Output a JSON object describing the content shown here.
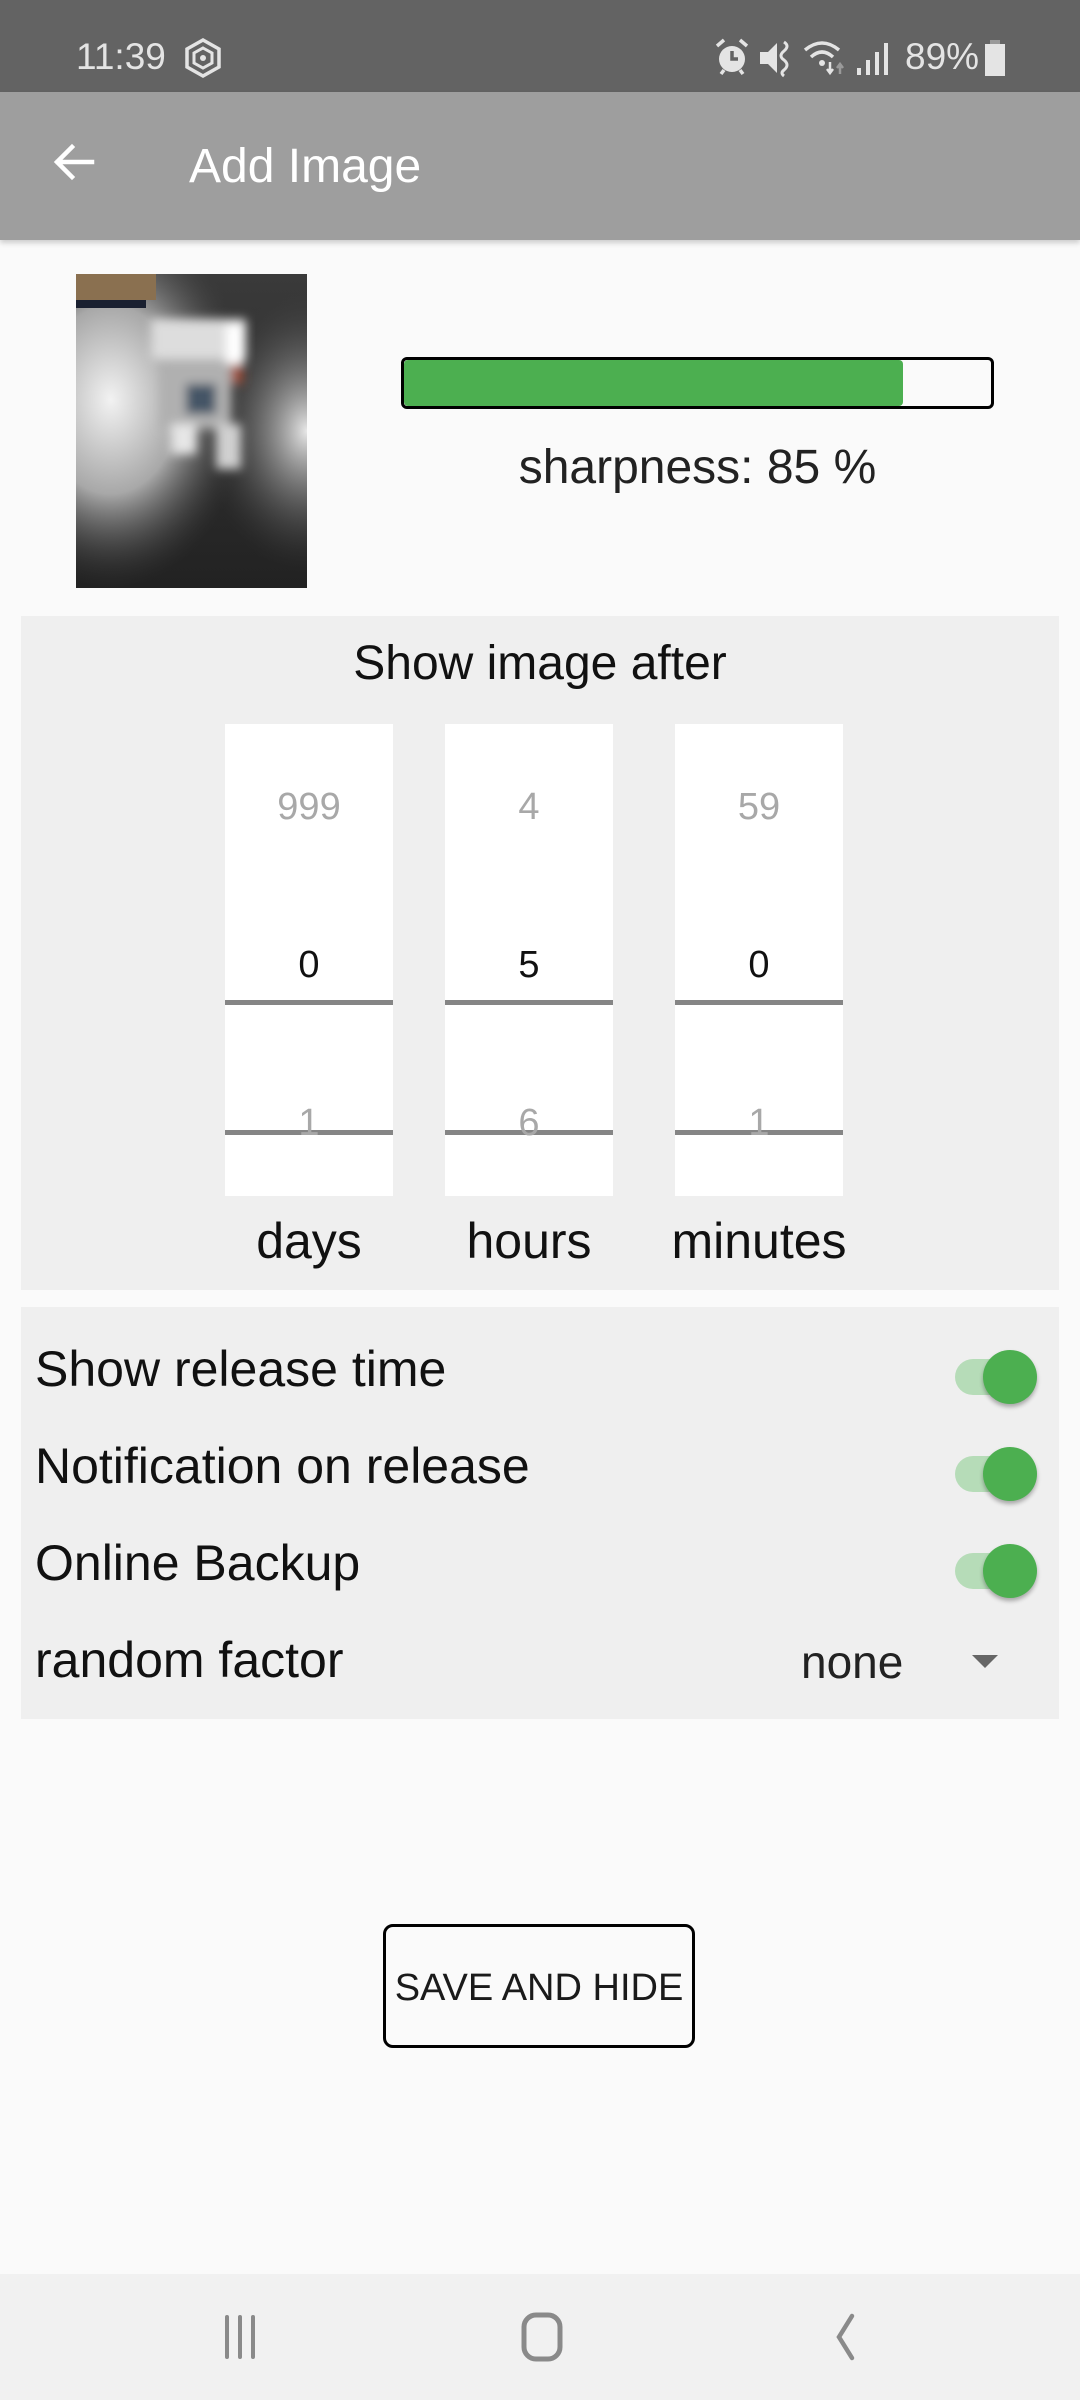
{
  "status_bar": {
    "time": "11:39",
    "icons": [
      "vpn-shield-icon",
      "alarm-icon",
      "vibrate-mute-icon",
      "wifi-icon",
      "signal-icon",
      "battery-icon"
    ],
    "battery": "89%"
  },
  "app_bar": {
    "title": "Add Image",
    "back_icon": "arrow-left-icon"
  },
  "preview": {
    "sharpness_percent": 85,
    "sharpness_label": "sharpness: 85 %",
    "bar_color": "#4caf50"
  },
  "release_delay": {
    "heading": "Show image after",
    "pickers": [
      {
        "name": "days",
        "prev": "999",
        "value": "0",
        "next": "1",
        "label": "days"
      },
      {
        "name": "hours",
        "prev": "4",
        "value": "5",
        "next": "6",
        "label": "hours"
      },
      {
        "name": "minutes",
        "prev": "59",
        "value": "0",
        "next": "1",
        "label": "minutes"
      }
    ]
  },
  "settings": {
    "items": [
      {
        "label": "Show release time",
        "type": "toggle",
        "checked": true
      },
      {
        "label": "Notification on release",
        "type": "toggle",
        "checked": true
      },
      {
        "label": "Online Backup",
        "type": "toggle",
        "checked": true
      },
      {
        "label": "random factor",
        "type": "dropdown",
        "value": "none"
      }
    ],
    "accent_color": "#4caf50"
  },
  "actions": {
    "save_label": "SAVE AND HIDE"
  },
  "nav_bar": {
    "recent": "recent-apps-icon",
    "home": "home-icon",
    "back": "back-icon"
  }
}
